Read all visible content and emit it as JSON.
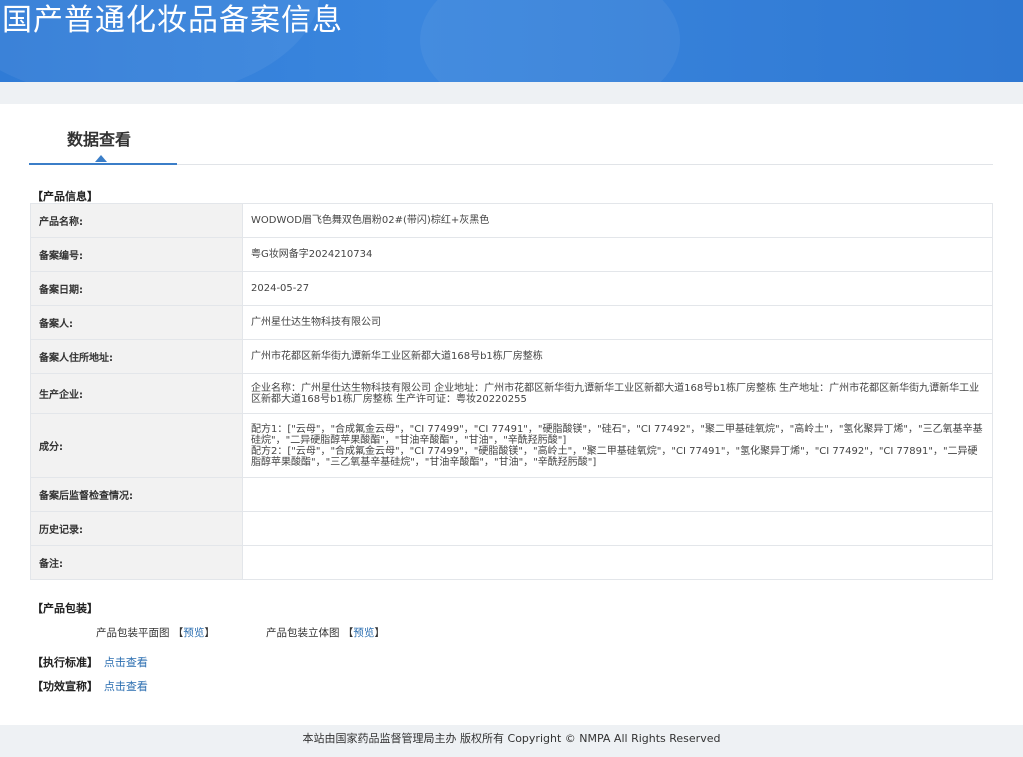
{
  "header": {
    "title": "国产普通化妆品备案信息"
  },
  "tab": {
    "label": "数据查看"
  },
  "sections": {
    "product_info": "【产品信息】",
    "packaging": "【产品包装】",
    "standard": "【执行标准】",
    "efficacy": "【功效宣称】"
  },
  "fields": [
    {
      "label": "产品名称:",
      "value": "WODWOD眉飞色舞双色眉粉02#(带闪)棕红+灰黑色"
    },
    {
      "label": "备案编号:",
      "value": "粤G妆网备字2024210734"
    },
    {
      "label": "备案日期:",
      "value": "2024-05-27"
    },
    {
      "label": "备案人:",
      "value": "广州星仕达生物科技有限公司"
    },
    {
      "label": "备案人住所地址:",
      "value": "广州市花都区新华街九谭新华工业区新都大道168号b1栋厂房整栋"
    },
    {
      "label": "生产企业:",
      "value": "企业名称：广州星仕达生物科技有限公司 企业地址：广州市花都区新华街九谭新华工业区新都大道168号b1栋厂房整栋 生产地址：广州市花都区新华街九谭新华工业区新都大道168号b1栋厂房整栋 生产许可证：粤妆20220255"
    },
    {
      "label": "成分:",
      "value_lines": [
        "配方1：[\"云母\"，\"合成氟金云母\"，\"CI 77499\"，\"CI 77491\"，\"硬脂酸镁\"，\"硅石\"，\"CI 77492\"，\"聚二甲基硅氧烷\"，\"高岭土\"，\"氢化聚异丁烯\"，\"三乙氧基辛基硅烷\"，\"二异硬脂醇苹果酸酯\"，\"甘油辛酸酯\"，\"甘油\"，\"辛酰羟肟酸\"]",
        "配方2：[\"云母\"，\"合成氟金云母\"，\"CI 77499\"，\"硬脂酸镁\"，\"高岭土\"，\"聚二甲基硅氧烷\"，\"CI 77491\"，\"氢化聚异丁烯\"，\"CI 77492\"，\"CI 77891\"，\"二异硬脂醇苹果酸酯\"，\"三乙氧基辛基硅烷\"，\"甘油辛酸酯\"，\"甘油\"，\"辛酰羟肟酸\"]"
      ]
    },
    {
      "label": "备案后监督检查情况:",
      "value": ""
    },
    {
      "label": "历史记录:",
      "value": ""
    },
    {
      "label": "备注:",
      "value": ""
    }
  ],
  "packaging": {
    "flat_label": "产品包装平面图",
    "flat_link": "预览",
    "solid_label": "产品包装立体图",
    "solid_link": "预览",
    "bracket_open": "【",
    "bracket_close": "】"
  },
  "links": {
    "standard": "点击查看",
    "efficacy": "点击查看"
  },
  "footer": {
    "text": "本站由国家药品监督管理局主办 版权所有 Copyright © NMPA All Rights Reserved"
  }
}
